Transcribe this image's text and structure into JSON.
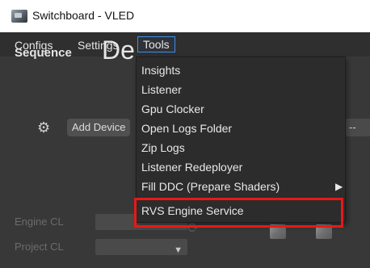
{
  "window": {
    "title": "Switchboard - VLED"
  },
  "menubar": {
    "configs": "Configs",
    "settings": "Settings",
    "tools": "Tools"
  },
  "sequence": {
    "label": "Sequence",
    "value": "De"
  },
  "toolbar": {
    "add_device": "Add Device",
    "right_combo_value": "--"
  },
  "rows": [
    {
      "label": "Engine CL",
      "combo_value": ""
    },
    {
      "label": "Project CL",
      "combo_value": ""
    }
  ],
  "tools_menu": {
    "items": [
      {
        "label": "Insights"
      },
      {
        "label": "Listener"
      },
      {
        "label": "Gpu Clocker"
      },
      {
        "label": "Open Logs Folder"
      },
      {
        "label": "Zip Logs"
      },
      {
        "label": "Listener Redeployer"
      },
      {
        "label": "Fill DDC (Prepare Shaders)",
        "has_submenu": true
      },
      {
        "label": "RVS Engine Service",
        "highlighted": true
      }
    ]
  },
  "colors": {
    "highlight": "#e81818",
    "accent": "#3f8ee8",
    "menu_bg": "#2c2c2c"
  },
  "icons": {
    "app": "app-icon",
    "settings": "gear-icon",
    "submenu": "chevron-right-icon",
    "refresh": "refresh-icon",
    "swap": "swap-icon",
    "device_a": "cube-icon",
    "device_b": "cube-icon"
  }
}
